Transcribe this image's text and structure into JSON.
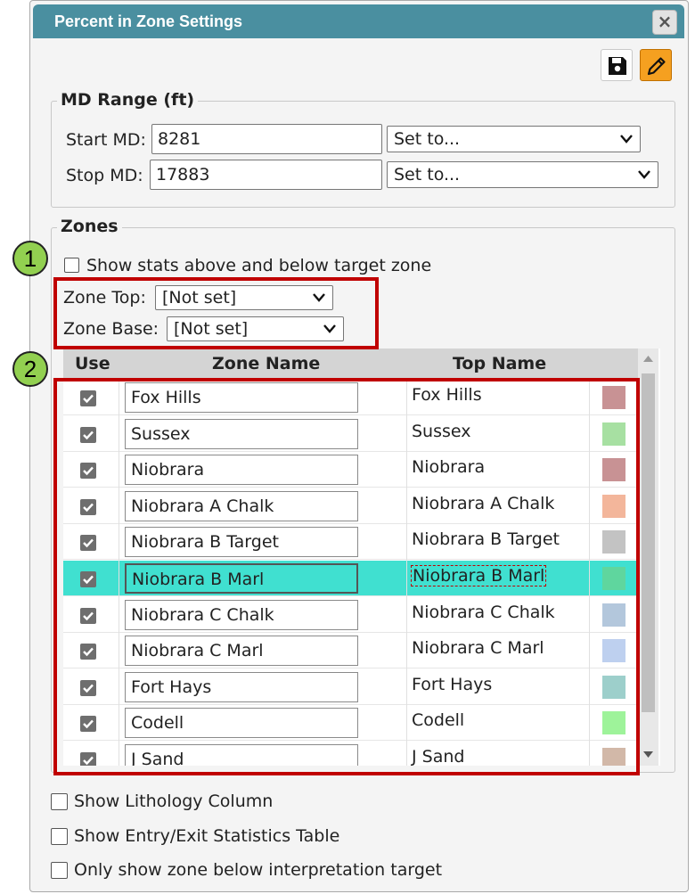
{
  "dialog": {
    "title": "Percent in Zone Settings",
    "close_label": "×"
  },
  "toolbar": {
    "save_icon": "floppy-disk-icon",
    "edit_icon": "pencil-icon"
  },
  "md_range": {
    "legend": "MD Range (ft)",
    "start_label": "Start MD:",
    "start_value": "8281",
    "start_set": "Set to...",
    "stop_label": "Stop MD:",
    "stop_value": "17883",
    "stop_set": "Set to..."
  },
  "zones": {
    "legend": "Zones",
    "show_stats_label": "Show stats above and below target zone",
    "zone_top_label": "Zone Top:",
    "zone_top_value": "[Not set]",
    "zone_base_label": "Zone Base:",
    "zone_base_value": "[Not set]"
  },
  "callouts": [
    "1",
    "2"
  ],
  "grid": {
    "headers": {
      "use": "Use",
      "zone_name": "Zone Name",
      "top_name": "Top Name"
    },
    "rows": [
      {
        "zone_name": "Fox Hills",
        "top_name": "Fox Hills",
        "color": "#c89294",
        "checked": true
      },
      {
        "zone_name": "Sussex",
        "top_name": "Sussex",
        "color": "#a7e0a2",
        "checked": true
      },
      {
        "zone_name": "Niobrara",
        "top_name": "Niobrara",
        "color": "#c89294",
        "checked": true
      },
      {
        "zone_name": "Niobrara A Chalk",
        "top_name": "Niobrara A Chalk",
        "color": "#f3b69b",
        "checked": true
      },
      {
        "zone_name": "Niobrara B Target",
        "top_name": "Niobrara B Target",
        "color": "#c3c3c3",
        "checked": true
      },
      {
        "zone_name": "Niobrara B Marl",
        "top_name": "Niobrara B Marl",
        "color": "#5fd69e",
        "checked": true,
        "selected": true
      },
      {
        "zone_name": "Niobrara C Chalk",
        "top_name": "Niobrara C Chalk",
        "color": "#b3c7dc",
        "checked": true
      },
      {
        "zone_name": "Niobrara C Marl",
        "top_name": "Niobrara C Marl",
        "color": "#bed0ef",
        "checked": true
      },
      {
        "zone_name": "Fort Hays",
        "top_name": "Fort Hays",
        "color": "#9dcfcb",
        "checked": true
      },
      {
        "zone_name": "Codell",
        "top_name": "Codell",
        "color": "#9ef39a",
        "checked": true
      },
      {
        "zone_name": "J Sand",
        "top_name": "J Sand",
        "color": "#d2b8a8",
        "checked": true
      }
    ]
  },
  "options": {
    "lithology": "Show Lithology Column",
    "entry_exit": "Show Entry/Exit Statistics Table",
    "only_below": "Only show zone below interpretation target"
  }
}
